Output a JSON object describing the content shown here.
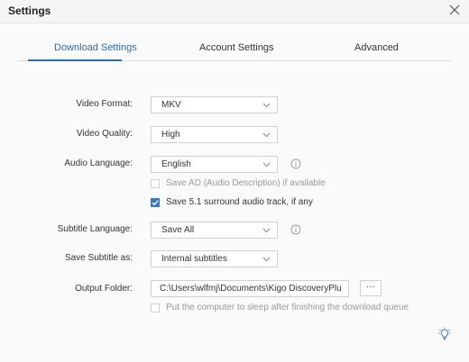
{
  "window": {
    "title": "Settings"
  },
  "tabs": [
    {
      "label": "Download Settings"
    },
    {
      "label": "Account Settings"
    },
    {
      "label": "Advanced"
    }
  ],
  "active_tab": "Download Settings",
  "form": {
    "video_format": {
      "label": "Video Format:",
      "value": "MKV"
    },
    "video_quality": {
      "label": "Video Quality:",
      "value": "High"
    },
    "audio_language": {
      "label": "Audio Language:",
      "value": "English"
    },
    "save_ad": {
      "label": "Save AD (Audio Description) if available",
      "checked": false
    },
    "save_51": {
      "label": "Save 5.1 surround audio track, if any",
      "checked": true
    },
    "subtitle_language": {
      "label": "Subtitle Language:",
      "value": "Save All"
    },
    "save_subtitle_as": {
      "label": "Save Subtitle as:",
      "value": "Internal subtitles"
    },
    "output_folder": {
      "label": "Output Folder:",
      "value": "C:\\Users\\wlfmj\\Documents\\Kigo DiscoveryPlu",
      "browse_label": "···"
    },
    "sleep_after": {
      "label": "Put the computer to sleep after finishing the download queue",
      "checked": false
    }
  },
  "colors": {
    "accent": "#2b6cb0",
    "checkbox": "#3b78c4",
    "bulb": "#3b78c4"
  },
  "icons": [
    "close-icon",
    "chevron-down-icon",
    "info-icon",
    "lightbulb-icon"
  ]
}
